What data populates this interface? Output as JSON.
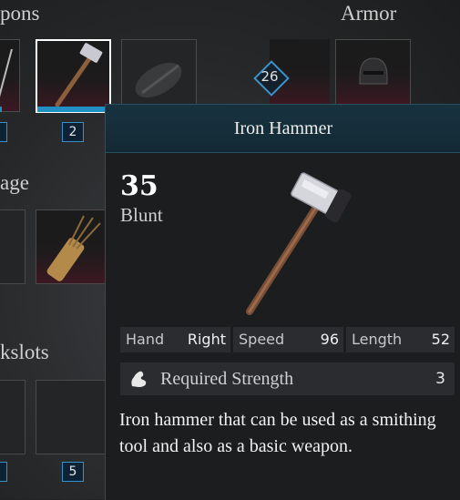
{
  "sections": {
    "weapons": "pons",
    "armor": "Armor",
    "storage": "age",
    "quickslots": "kslots"
  },
  "slots": {
    "hammer_qty": "2",
    "quickslot_qty": "5"
  },
  "armor_badge": "26",
  "colors": {
    "accent": "#1f8fc4",
    "header": "#17323f"
  },
  "tooltip": {
    "title": "Iron Hammer",
    "damage_value": "35",
    "damage_type": "Blunt",
    "stats": [
      {
        "key": "Hand",
        "value": "Right"
      },
      {
        "key": "Speed",
        "value": "96"
      },
      {
        "key": "Length",
        "value": "52"
      }
    ],
    "requirement": {
      "icon": "strength-arm-icon",
      "label": "Required Strength",
      "value": "3"
    },
    "description": "Iron hammer that can be used as a smithing tool and also as a basic weapon."
  }
}
